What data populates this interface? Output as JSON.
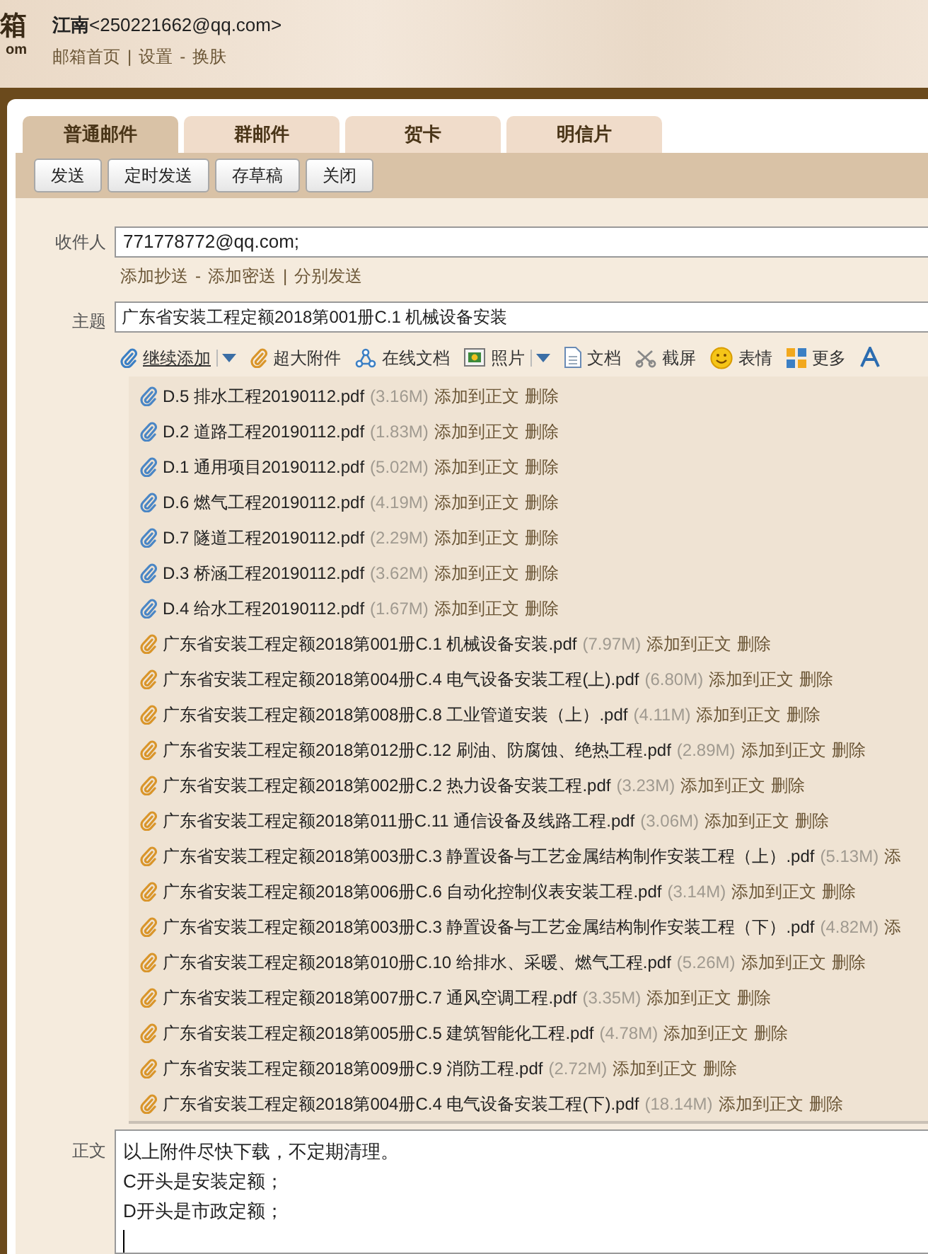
{
  "logo_fragment": [
    "箱",
    "om"
  ],
  "user": {
    "name": "江南",
    "email": "<250221662@qq.com>"
  },
  "nav": [
    {
      "label": "邮箱首页"
    },
    {
      "sep": "|",
      "label": "设置"
    },
    {
      "sep": "-",
      "label": "换肤"
    }
  ],
  "tabs": [
    {
      "label": "普通邮件",
      "selected": true
    },
    {
      "label": "群邮件",
      "selected": false
    },
    {
      "label": "贺卡",
      "selected": false
    },
    {
      "label": "明信片",
      "selected": false
    }
  ],
  "actions": [
    "发送",
    "定时发送",
    "存草稿",
    "关闭"
  ],
  "recipient": {
    "label": "收件人",
    "value": "771778772@qq.com;"
  },
  "recipient_links": [
    {
      "label": "添加抄送"
    },
    {
      "sep": "-",
      "label": "添加密送"
    },
    {
      "sep": "|",
      "label": "分别发送"
    }
  ],
  "subject": {
    "label": "主题",
    "value": "广东省安装工程定额2018第001册C.1 机械设备安装"
  },
  "attach_toolbar": [
    {
      "kind": "attach",
      "label": "继续添加",
      "dropdown": true
    },
    {
      "kind": "large",
      "label": "超大附件",
      "dropdown": false
    },
    {
      "kind": "online",
      "label": "在线文档",
      "dropdown": false
    },
    {
      "kind": "photo",
      "label": "照片",
      "dropdown": true
    },
    {
      "kind": "doc",
      "label": "文档",
      "dropdown": false
    },
    {
      "kind": "screenshot",
      "label": "截屏",
      "dropdown": false
    },
    {
      "kind": "emoji",
      "label": "表情",
      "dropdown": false
    },
    {
      "kind": "more",
      "label": "更多",
      "dropdown": false
    },
    {
      "kind": "font",
      "dropdown": false
    }
  ],
  "attachments": [
    {
      "kind": "regular",
      "name": "D.5 排水工程20190112.pdf",
      "size": "(3.16M)",
      "add": "添加到正文",
      "delete": "删除"
    },
    {
      "kind": "regular",
      "name": "D.2 道路工程20190112.pdf",
      "size": "(1.83M)",
      "add": "添加到正文",
      "delete": "删除"
    },
    {
      "kind": "regular",
      "name": "D.1 通用项目20190112.pdf",
      "size": "(5.02M)",
      "add": "添加到正文",
      "delete": "删除"
    },
    {
      "kind": "regular",
      "name": "D.6 燃气工程20190112.pdf",
      "size": "(4.19M)",
      "add": "添加到正文",
      "delete": "删除"
    },
    {
      "kind": "regular",
      "name": "D.7 隧道工程20190112.pdf",
      "size": "(2.29M)",
      "add": "添加到正文",
      "delete": "删除"
    },
    {
      "kind": "regular",
      "name": "D.3 桥涵工程20190112.pdf",
      "size": "(3.62M)",
      "add": "添加到正文",
      "delete": "删除"
    },
    {
      "kind": "regular",
      "name": "D.4 给水工程20190112.pdf",
      "size": "(1.67M)",
      "add": "添加到正文",
      "delete": "删除"
    },
    {
      "kind": "large",
      "name": "广东省安装工程定额2018第001册C.1 机械设备安装.pdf",
      "size": "(7.97M)",
      "add": "添加到正文",
      "delete": "删除"
    },
    {
      "kind": "large",
      "name": "广东省安装工程定额2018第004册C.4 电气设备安装工程(上).pdf",
      "size": "(6.80M)",
      "add": "添加到正文",
      "delete": "删除"
    },
    {
      "kind": "large",
      "name": "广东省安装工程定额2018第008册C.8 工业管道安装（上）.pdf",
      "size": "(4.11M)",
      "add": "添加到正文",
      "delete": "删除"
    },
    {
      "kind": "large",
      "name": "广东省安装工程定额2018第012册C.12 刷油、防腐蚀、绝热工程.pdf",
      "size": "(2.89M)",
      "add": "添加到正文",
      "delete": "删除"
    },
    {
      "kind": "large",
      "name": "广东省安装工程定额2018第002册C.2 热力设备安装工程.pdf",
      "size": "(3.23M)",
      "add": "添加到正文",
      "delete": "删除"
    },
    {
      "kind": "large",
      "name": "广东省安装工程定额2018第011册C.11 通信设备及线路工程.pdf",
      "size": "(3.06M)",
      "add": "添加到正文",
      "delete": "删除"
    },
    {
      "kind": "large",
      "name": "广东省安装工程定额2018第003册C.3 静置设备与工艺金属结构制作安装工程（上）.pdf",
      "size": "(5.13M)",
      "add": "添"
    },
    {
      "kind": "large",
      "name": "广东省安装工程定额2018第006册C.6 自动化控制仪表安装工程.pdf",
      "size": "(3.14M)",
      "add": "添加到正文",
      "delete": "删除"
    },
    {
      "kind": "large",
      "name": "广东省安装工程定额2018第003册C.3 静置设备与工艺金属结构制作安装工程（下）.pdf",
      "size": "(4.82M)",
      "add": "添"
    },
    {
      "kind": "large",
      "name": "广东省安装工程定额2018第010册C.10 给排水、采暖、燃气工程.pdf",
      "size": "(5.26M)",
      "add": "添加到正文",
      "delete": "删除"
    },
    {
      "kind": "large",
      "name": "广东省安装工程定额2018第007册C.7 通风空调工程.pdf",
      "size": "(3.35M)",
      "add": "添加到正文",
      "delete": "删除"
    },
    {
      "kind": "large",
      "name": "广东省安装工程定额2018第005册C.5 建筑智能化工程.pdf",
      "size": "(4.78M)",
      "add": "添加到正文",
      "delete": "删除"
    },
    {
      "kind": "large",
      "name": "广东省安装工程定额2018第009册C.9 消防工程.pdf",
      "size": "(2.72M)",
      "add": "添加到正文",
      "delete": "删除"
    },
    {
      "kind": "large",
      "name": "广东省安装工程定额2018第004册C.4 电气设备安装工程(下).pdf",
      "size": "(18.14M)",
      "add": "添加到正文",
      "delete": "删除"
    }
  ],
  "body": {
    "label": "正文",
    "lines": [
      "以上附件尽快下载，不定期清理。",
      "C开头是安装定额；",
      "D开头是市政定额；"
    ]
  }
}
